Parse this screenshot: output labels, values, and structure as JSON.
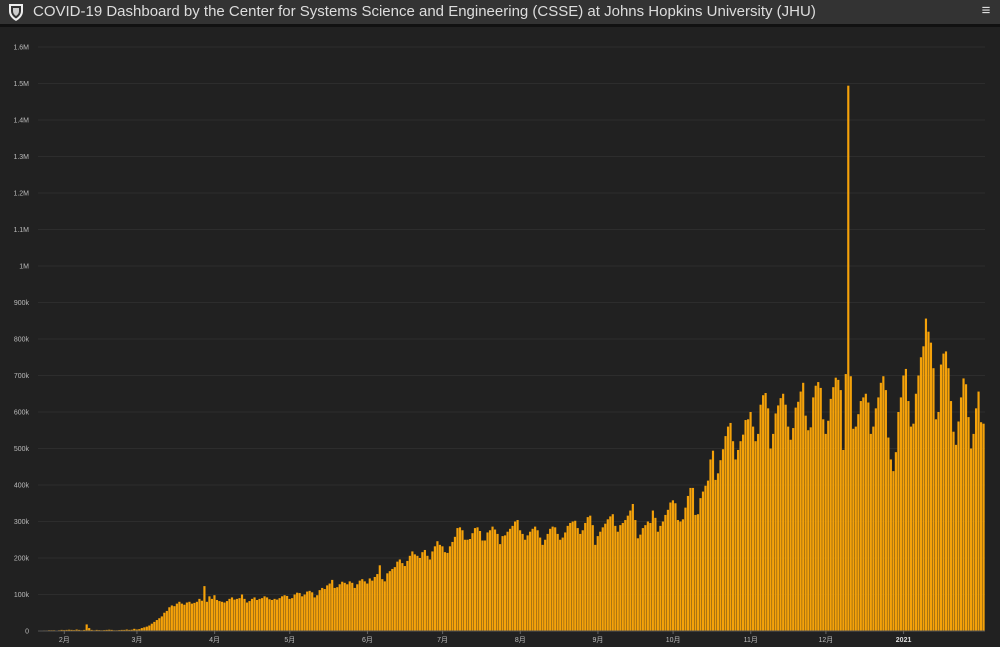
{
  "header": {
    "title": "COVID-19 Dashboard by the Center for Systems Science and Engineering (CSSE) at Johns Hopkins University (JHU)",
    "logo_icon": "jhu-shield-icon",
    "menu_icon": "hamburger-menu-icon"
  },
  "colors": {
    "bar": "#f5a20a",
    "bar_edge": "#c87f00",
    "background": "#222222",
    "header": "#333333"
  },
  "chart_data": {
    "type": "bar",
    "ylim": [
      0,
      1600000
    ],
    "y_ticks": [
      {
        "value": 0,
        "label": "0"
      },
      {
        "value": 100000,
        "label": "100k"
      },
      {
        "value": 200000,
        "label": "200k"
      },
      {
        "value": 300000,
        "label": "300k"
      },
      {
        "value": 400000,
        "label": "400k"
      },
      {
        "value": 500000,
        "label": "500k"
      },
      {
        "value": 600000,
        "label": "600k"
      },
      {
        "value": 700000,
        "label": "700k"
      },
      {
        "value": 800000,
        "label": "800k"
      },
      {
        "value": 900000,
        "label": "900k"
      },
      {
        "value": 1000000,
        "label": "1M"
      },
      {
        "value": 1100000,
        "label": "1.1M"
      },
      {
        "value": 1200000,
        "label": "1.2M"
      },
      {
        "value": 1300000,
        "label": "1.3M"
      },
      {
        "value": 1400000,
        "label": "1.4M"
      },
      {
        "value": 1500000,
        "label": "1.5M"
      },
      {
        "value": 1600000,
        "label": "1.6M"
      }
    ],
    "x_ticks": [
      {
        "index": 10,
        "label": "2月",
        "bold": false
      },
      {
        "index": 39,
        "label": "3月",
        "bold": false
      },
      {
        "index": 70,
        "label": "4月",
        "bold": false
      },
      {
        "index": 100,
        "label": "5月",
        "bold": false
      },
      {
        "index": 131,
        "label": "6月",
        "bold": false
      },
      {
        "index": 161,
        "label": "7月",
        "bold": false
      },
      {
        "index": 192,
        "label": "8月",
        "bold": false
      },
      {
        "index": 223,
        "label": "9月",
        "bold": false
      },
      {
        "index": 253,
        "label": "10月",
        "bold": false
      },
      {
        "index": 284,
        "label": "11月",
        "bold": false
      },
      {
        "index": 314,
        "label": "12月",
        "bold": false
      },
      {
        "index": 345,
        "label": "2021",
        "bold": true
      }
    ],
    "values": [
      1000,
      1000,
      1500,
      1500,
      2000,
      2000,
      2000,
      1000,
      2000,
      3000,
      2500,
      3000,
      3500,
      3000,
      2500,
      4000,
      3000,
      2000,
      3000,
      18000,
      8000,
      3000,
      2000,
      3000,
      2500,
      2000,
      2500,
      3000,
      3500,
      3000,
      2000,
      2000,
      2500,
      3000,
      3000,
      4000,
      3000,
      3500,
      6000,
      4000,
      5000,
      8000,
      10000,
      12000,
      15000,
      20000,
      25000,
      30000,
      35000,
      40000,
      50000,
      55000,
      65000,
      70000,
      68000,
      75000,
      80000,
      75000,
      72000,
      78000,
      80000,
      75000,
      77000,
      80000,
      88000,
      83000,
      123000,
      80000,
      95000,
      88000,
      98000,
      85000,
      82000,
      80000,
      78000,
      82000,
      88000,
      92000,
      86000,
      88000,
      90000,
      100000,
      88000,
      78000,
      82000,
      88000,
      92000,
      85000,
      88000,
      90000,
      95000,
      92000,
      87000,
      85000,
      88000,
      86000,
      90000,
      95000,
      98000,
      96000,
      88000,
      90000,
      100000,
      105000,
      104000,
      95000,
      100000,
      108000,
      110000,
      106000,
      92000,
      98000,
      112000,
      118000,
      115000,
      125000,
      130000,
      140000,
      118000,
      120000,
      128000,
      135000,
      132000,
      128000,
      136000,
      132000,
      118000,
      128000,
      138000,
      142000,
      136000,
      130000,
      144000,
      138000,
      148000,
      156000,
      180000,
      142000,
      136000,
      158000,
      164000,
      170000,
      175000,
      190000,
      196000,
      186000,
      178000,
      192000,
      206000,
      218000,
      210000,
      206000,
      200000,
      216000,
      222000,
      206000,
      196000,
      218000,
      232000,
      246000,
      236000,
      232000,
      216000,
      214000,
      232000,
      244000,
      258000,
      282000,
      284000,
      276000,
      250000,
      250000,
      252000,
      268000,
      282000,
      284000,
      274000,
      248000,
      248000,
      270000,
      276000,
      286000,
      278000,
      266000,
      238000,
      260000,
      262000,
      272000,
      280000,
      288000,
      300000,
      304000,
      276000,
      266000,
      250000,
      262000,
      272000,
      280000,
      286000,
      276000,
      256000,
      236000,
      250000,
      266000,
      280000,
      286000,
      284000,
      266000,
      250000,
      256000,
      270000,
      288000,
      296000,
      300000,
      302000,
      282000,
      266000,
      276000,
      296000,
      312000,
      316000,
      290000,
      236000,
      260000,
      272000,
      284000,
      294000,
      306000,
      314000,
      320000,
      288000,
      272000,
      290000,
      296000,
      304000,
      316000,
      330000,
      348000,
      304000,
      254000,
      264000,
      282000,
      290000,
      300000,
      296000,
      330000,
      310000,
      272000,
      288000,
      300000,
      318000,
      332000,
      352000,
      358000,
      350000,
      304000,
      300000,
      306000,
      338000,
      370000,
      392000,
      392000,
      318000,
      320000,
      364000,
      382000,
      398000,
      412000,
      470000,
      494000,
      414000,
      432000,
      468000,
      498000,
      534000,
      560000,
      570000,
      520000,
      470000,
      496000,
      520000,
      538000,
      578000,
      580000,
      600000,
      560000,
      520000,
      540000,
      620000,
      646000,
      652000,
      610000,
      500000,
      540000,
      596000,
      618000,
      638000,
      650000,
      620000,
      560000,
      524000,
      556000,
      612000,
      628000,
      656000,
      680000,
      590000,
      550000,
      558000,
      640000,
      672000,
      682000,
      666000,
      580000,
      540000,
      576000,
      636000,
      668000,
      694000,
      688000,
      660000,
      496000,
      704000,
      1494000,
      698000,
      554000,
      560000,
      594000,
      630000,
      640000,
      650000,
      626000,
      540000,
      560000,
      610000,
      640000,
      680000,
      698000,
      660000,
      530000,
      470000,
      438000,
      490000,
      600000,
      640000,
      700000,
      718000,
      630000,
      560000,
      568000,
      650000,
      700000,
      750000,
      780000,
      856000,
      820000,
      790000,
      720000,
      580000,
      600000,
      730000,
      760000,
      766000,
      720000,
      630000,
      546000,
      510000,
      574000,
      640000,
      692000,
      676000,
      586000,
      500000,
      540000,
      610000,
      656000,
      572000,
      568000
    ]
  }
}
